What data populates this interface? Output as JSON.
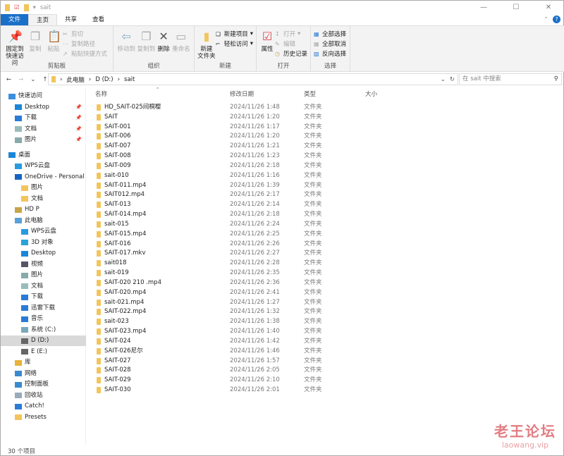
{
  "window": {
    "title": "sait",
    "minimize": "—",
    "maximize": "☐",
    "close": "✕"
  },
  "tabs": [
    "文件",
    "主页",
    "共享",
    "查看"
  ],
  "ribbon": {
    "clipboard": {
      "label": "剪贴板",
      "pin": "固定到快速访问",
      "copy": "复制",
      "paste": "粘贴",
      "cut": "剪切",
      "copy_path": "复制路径",
      "paste_shortcut": "粘贴快捷方式"
    },
    "organize": {
      "label": "组织",
      "move_to": "移动到",
      "copy_to": "复制到",
      "delete": "删除",
      "rename": "重命名"
    },
    "new": {
      "label": "新建",
      "new_folder": "新建\n文件夹",
      "new_item": "新建项目",
      "easy_access": "轻松访问"
    },
    "open": {
      "label": "打开",
      "properties": "属性",
      "open": "打开",
      "edit": "编辑",
      "history": "历史记录"
    },
    "select": {
      "label": "选择",
      "select_all": "全部选择",
      "select_none": "全部取消",
      "invert": "反向选择"
    }
  },
  "address": {
    "crumbs": [
      "此电脑",
      "D (D:)",
      "sait"
    ],
    "search_placeholder": "在 sait 中搜索"
  },
  "sidebar": [
    {
      "label": "快速访问",
      "icon": "star-icon",
      "indent": 1,
      "color": "#3c8ee0"
    },
    {
      "label": "Desktop",
      "icon": "desktop-icon",
      "indent": 2,
      "pinned": true,
      "color": "#1a86d9"
    },
    {
      "label": "下载",
      "icon": "download-icon",
      "indent": 2,
      "pinned": true,
      "color": "#2a7bd6"
    },
    {
      "label": "文档",
      "icon": "document-icon",
      "indent": 2,
      "pinned": true,
      "color": "#9bb"
    },
    {
      "label": "图片",
      "icon": "pictures-icon",
      "indent": 2,
      "pinned": true,
      "color": "#8aa"
    },
    {
      "label": "桌面",
      "icon": "desktop-icon",
      "indent": 1,
      "color": "#1a86d9",
      "gap": true
    },
    {
      "label": "WPS云盘",
      "icon": "cloud-icon",
      "indent": 2,
      "color": "#2a9ae0"
    },
    {
      "label": "OneDrive - Personal",
      "icon": "onedrive-icon",
      "indent": 2,
      "color": "#1565c0"
    },
    {
      "label": "图片",
      "icon": "folder-icon",
      "indent": 3,
      "color": "#f2c55c"
    },
    {
      "label": "文档",
      "icon": "folder-icon",
      "indent": 3,
      "color": "#f2c55c"
    },
    {
      "label": "HD P",
      "icon": "user-icon",
      "indent": 2,
      "color": "#c9a54a"
    },
    {
      "label": "此电脑",
      "icon": "computer-icon",
      "indent": 2,
      "color": "#5aa0d8"
    },
    {
      "label": "WPS云盘",
      "icon": "cloud-icon",
      "indent": 3,
      "color": "#2a9ae0"
    },
    {
      "label": "3D 对象",
      "icon": "3d-objects-icon",
      "indent": 3,
      "color": "#29a3d9"
    },
    {
      "label": "Desktop",
      "icon": "desktop-icon",
      "indent": 3,
      "color": "#1a86d9"
    },
    {
      "label": "视频",
      "icon": "video-icon",
      "indent": 3,
      "color": "#556"
    },
    {
      "label": "图片",
      "icon": "pictures-icon",
      "indent": 3,
      "color": "#8aa"
    },
    {
      "label": "文档",
      "icon": "document-icon",
      "indent": 3,
      "color": "#9bb"
    },
    {
      "label": "下载",
      "icon": "download-icon",
      "indent": 3,
      "color": "#2a7bd6"
    },
    {
      "label": "迅雷下载",
      "icon": "thunder-icon",
      "indent": 3,
      "color": "#2a7bd6"
    },
    {
      "label": "音乐",
      "icon": "music-icon",
      "indent": 3,
      "color": "#2a7bd6"
    },
    {
      "label": "系统 (C:)",
      "icon": "drive-icon",
      "indent": 3,
      "color": "#7ab"
    },
    {
      "label": "D (D:)",
      "icon": "drive-icon",
      "indent": 3,
      "color": "#666",
      "selected": true
    },
    {
      "label": "E (E:)",
      "icon": "drive-icon",
      "indent": 3,
      "color": "#666"
    },
    {
      "label": "库",
      "icon": "library-icon",
      "indent": 2,
      "color": "#e8b33a"
    },
    {
      "label": "网络",
      "icon": "network-icon",
      "indent": 2,
      "color": "#3a8ad0"
    },
    {
      "label": "控制面板",
      "icon": "control-panel-icon",
      "indent": 2,
      "color": "#3a8ad0"
    },
    {
      "label": "回收站",
      "icon": "recycle-bin-icon",
      "indent": 2,
      "color": "#9ab"
    },
    {
      "label": "Catch!",
      "icon": "catch-icon",
      "indent": 2,
      "color": "#2a7bd6"
    },
    {
      "label": "Presets",
      "icon": "folder-icon",
      "indent": 2,
      "color": "#f2c55c"
    }
  ],
  "columns": [
    "名称",
    "修改日期",
    "类型",
    "大小"
  ],
  "files": [
    [
      "HD_SAIT-025间桐樱",
      "2024/11/26 1:48"
    ],
    [
      "SAIT",
      "2024/11/26 1:20"
    ],
    [
      "SAIT-001",
      "2024/11/26 1:17"
    ],
    [
      "SAIT-006",
      "2024/11/26 1:20"
    ],
    [
      "SAIT-007",
      "2024/11/26 1:21"
    ],
    [
      "SAIT-008",
      "2024/11/26 1:23"
    ],
    [
      "SAIT-009",
      "2024/11/26 2:18"
    ],
    [
      "sait-010",
      "2024/11/26 1:16"
    ],
    [
      "SAIT-011.mp4",
      "2024/11/26 1:39"
    ],
    [
      "SAIT012.mp4",
      "2024/11/26 2:17"
    ],
    [
      "SAIT-013",
      "2024/11/26 2:14"
    ],
    [
      "SAIT-014.mp4",
      "2024/11/26 2:18"
    ],
    [
      "sait-015",
      "2024/11/26 2:24"
    ],
    [
      "SAIT-015.mp4",
      "2024/11/26 2:25"
    ],
    [
      "SAIT-016",
      "2024/11/26 2:26"
    ],
    [
      "SAIT-017.mkv",
      "2024/11/26 2:27"
    ],
    [
      "sait018",
      "2024/11/26 2:28"
    ],
    [
      "sait-019",
      "2024/11/26 2:35"
    ],
    [
      "SAIT-020 210 .mp4",
      "2024/11/26 2:36"
    ],
    [
      "SAIT-020.mp4",
      "2024/11/26 2:41"
    ],
    [
      "sait-021.mp4",
      "2024/11/26 1:27"
    ],
    [
      "SAIT-022.mp4",
      "2024/11/26 1:32"
    ],
    [
      "sait-023",
      "2024/11/26 1:38"
    ],
    [
      "SAIT-023.mp4",
      "2024/11/26 1:40"
    ],
    [
      "SAIT-024",
      "2024/11/26 1:42"
    ],
    [
      "SAIT-026尼尔",
      "2024/11/26 1:46"
    ],
    [
      "SAIT-027",
      "2024/11/26 1:57"
    ],
    [
      "SAIT-028",
      "2024/11/26 2:05"
    ],
    [
      "SAIT-029",
      "2024/11/26 2:10"
    ],
    [
      "SAIT-030",
      "2024/11/26 2:01"
    ]
  ],
  "file_type": "文件夹",
  "status": "30 个项目",
  "watermark": {
    "title": "老王论坛",
    "url": "laowang.vip"
  }
}
